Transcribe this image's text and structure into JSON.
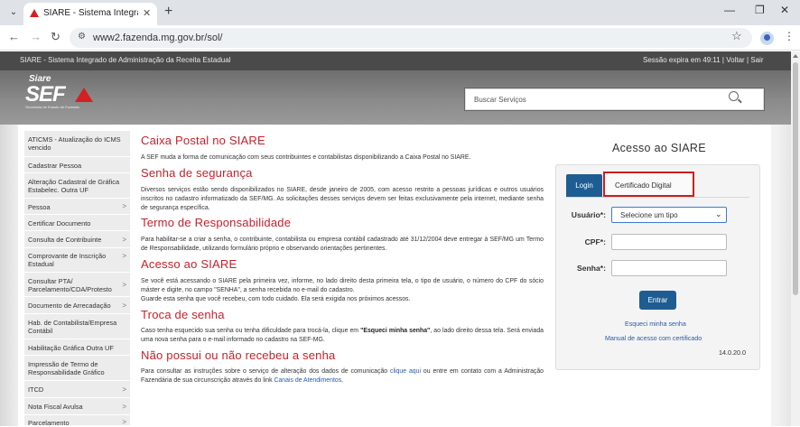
{
  "browser": {
    "tab_title": "SIARE - Sistema Integrado de Admini",
    "url": "www2.fazenda.mg.gov.br/sol/"
  },
  "site": {
    "title": "SIARE - Sistema Integrado de Administração da Receita Estadual",
    "session": "Sessão expira em 49:11",
    "voltar": "Voltar",
    "sair": "Sair",
    "logo_siare": "Siare",
    "logo_sef": "SEF",
    "logo_sub": "Secretaria de Estado de Fazenda",
    "search_placeholder": "Buscar Serviços"
  },
  "sidebar": {
    "items": [
      {
        "label": "ATICMS - Atualização do ICMS vencido",
        "arrow": ""
      },
      {
        "label": "Cadastrar Pessoa",
        "arrow": ""
      },
      {
        "label": "Alteração Cadastral de Gráfica Estabelec. Outra UF",
        "arrow": ""
      },
      {
        "label": "Pessoa",
        "arrow": ">"
      },
      {
        "label": "Certificar Documento",
        "arrow": ""
      },
      {
        "label": "Consulta de Contribuinte",
        "arrow": ">"
      },
      {
        "label": "Comprovante de Inscrição Estadual",
        "arrow": ">"
      },
      {
        "label": "Consultar PTA/ Parcelamento/CDA/Protesto",
        "arrow": ">"
      },
      {
        "label": "Documento de Arrecadação",
        "arrow": ">"
      },
      {
        "label": "Hab. de Contabilista/Empresa Contábil",
        "arrow": ""
      },
      {
        "label": "Habilitação Gráfica Outra UF",
        "arrow": ""
      },
      {
        "label": "Impressão de Termo de Responsabilidade Gráfico",
        "arrow": ""
      },
      {
        "label": "ITCD",
        "arrow": ">"
      },
      {
        "label": "Nota Fiscal Avulsa",
        "arrow": ">"
      },
      {
        "label": "Parcelamento",
        "arrow": ">"
      }
    ]
  },
  "main": {
    "s1_title": "Caixa Postal no SIARE",
    "s1_text": "A SEF muda a forma de comunicação com seus contribuintes e contabilistas disponibilizando a Caixa Postal no SIARE.",
    "s2_title": "Senha de segurança",
    "s2_text": "Diversos serviços estão sendo disponibilizados no SIARE, desde janeiro de 2005, com acesso restrito a pessoas jurídicas e outros usuários inscritos no cadastro informatizado da SEF/MG. As solicitações desses serviços devem ser feitas exclusivamente pela internet, mediante senha de segurança específica.",
    "s3_title": "Termo de Responsabilidade",
    "s3_text": "Para habilitar-se a criar a senha, o contribuinte, contabilista ou empresa contábil cadastrado até 31/12/2004 deve entregar à SEF/MG um Termo de Responsabilidade, utilizando formulário próprio e observando orientações pertinentes.",
    "s4_title": "Acesso ao SIARE",
    "s4_text": "Se você está acessando o SIARE pela primeira vez, informe, no lado direito desta primeira tela, o tipo de usuário, o número do CPF do sócio máster e digite, no campo \"SENHA\", a senha recebida no e-mail do cadastro.",
    "s4_text2": "Guarde esta senha que você recebeu, com todo cuidado. Ela será exigida nos próximos acessos.",
    "s5_title": "Troca de senha",
    "s5_text_a": "Caso tenha esquecido sua senha ou tenha dificuldade para trocá-la, clique em ",
    "s5_bold": "\"Esqueci minha senha\"",
    "s5_text_b": ", ao lado direito dessa tela. Será enviada uma nova senha para o e-mail informado no cadastro na SEF-MG.",
    "s6_title": "Não possui ou não recebeu a senha",
    "s6_text_a": "Para consultar as instruções sobre o serviço de alteração dos dados de comunicação ",
    "s6_link1": "clique aqui",
    "s6_text_b": " ou entre em contato com a Administração Fazendária de sua circunscrição através do link ",
    "s6_link2": "Canais de Atendimentos",
    "s6_text_c": "."
  },
  "login": {
    "title": "Acesso ao SIARE",
    "tab_login": "Login",
    "tab_cert": "Certificado Digital",
    "user_label": "Usuário*:",
    "user_select": "Selecione um tipo",
    "cpf_label": "CPF*:",
    "senha_label": "Senha*:",
    "entrar": "Entrar",
    "forgot": "Esqueci minha senha",
    "manual": "Manual de acesso com certificado",
    "version": "14.0.20.0"
  }
}
